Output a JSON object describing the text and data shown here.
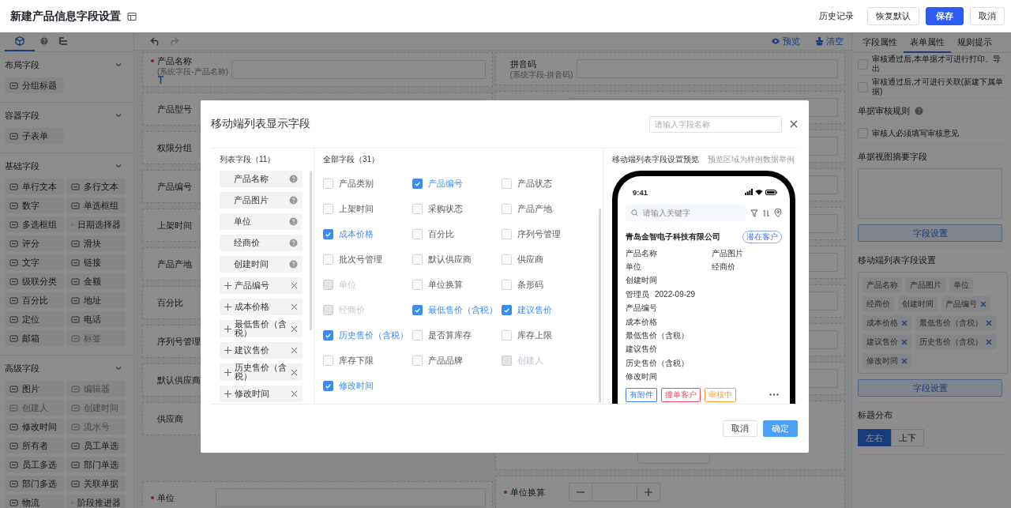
{
  "header": {
    "title": "新建产品信息字段设置",
    "actions": [
      {
        "label": "历史记录",
        "kind": "link"
      },
      {
        "label": "恢复默认",
        "kind": "default"
      },
      {
        "label": "保存",
        "kind": "primary"
      },
      {
        "label": "取消",
        "kind": "default"
      }
    ]
  },
  "palette": {
    "tabs": [
      {
        "selected": true
      },
      {
        "selected": false
      },
      {
        "selected": false
      }
    ],
    "groups": [
      {
        "title": "布局字段",
        "expanded": true,
        "items": [
          {
            "label": "分组标题",
            "disabled": false
          }
        ]
      },
      {
        "title": "容器字段",
        "expanded": true,
        "items": [
          {
            "label": "子表单",
            "disabled": false
          }
        ]
      },
      {
        "title": "基础字段",
        "expanded": true,
        "items": [
          {
            "label": "单行文本",
            "disabled": false
          },
          {
            "label": "多行文本",
            "disabled": false
          },
          {
            "label": "数字",
            "disabled": false
          },
          {
            "label": "单选框组",
            "disabled": false
          },
          {
            "label": "多选框组",
            "disabled": false
          },
          {
            "label": "日期选择器",
            "disabled": false
          },
          {
            "label": "评分",
            "disabled": false
          },
          {
            "label": "滑块",
            "disabled": false
          },
          {
            "label": "文字",
            "disabled": false
          },
          {
            "label": "链接",
            "disabled": false
          },
          {
            "label": "级联分类",
            "disabled": false
          },
          {
            "label": "金额",
            "disabled": false
          },
          {
            "label": "百分比",
            "disabled": false
          },
          {
            "label": "地址",
            "disabled": false
          },
          {
            "label": "定位",
            "disabled": false
          },
          {
            "label": "电话",
            "disabled": false
          },
          {
            "label": "邮箱",
            "disabled": false
          },
          {
            "label": "标签",
            "disabled": true
          }
        ]
      },
      {
        "title": "高级字段",
        "expanded": true,
        "items": [
          {
            "label": "图片",
            "disabled": false
          },
          {
            "label": "编辑器",
            "disabled": true
          },
          {
            "label": "创建人",
            "disabled": true
          },
          {
            "label": "创建时间",
            "disabled": true
          },
          {
            "label": "修改时间",
            "disabled": false
          },
          {
            "label": "流水号",
            "disabled": true
          },
          {
            "label": "所有者",
            "disabled": false
          },
          {
            "label": "员工单选",
            "disabled": false
          },
          {
            "label": "员工多选",
            "disabled": false
          },
          {
            "label": "部门单选",
            "disabled": false
          },
          {
            "label": "部门多选",
            "disabled": false
          },
          {
            "label": "关联单据",
            "disabled": false
          },
          {
            "label": "物流",
            "disabled": false
          },
          {
            "label": "阶段推进器",
            "disabled": false
          }
        ]
      }
    ]
  },
  "canvas": {
    "actions": [
      {
        "label": "预览",
        "kind": "preview"
      },
      {
        "label": "清空",
        "kind": "clear"
      }
    ],
    "left_fields": [
      {
        "label": "产品名称",
        "hint": "(系统字段-产品名称)",
        "required": true,
        "selected": true
      },
      {
        "label": "产品型号",
        "required": false,
        "selected": false
      },
      {
        "label": "权限分组",
        "required": false,
        "selected": false
      },
      {
        "label": "产品编号",
        "required": false,
        "selected": false
      },
      {
        "label": "上架时间",
        "required": false,
        "selected": false
      },
      {
        "label": "产品产地",
        "required": false,
        "selected": false
      },
      {
        "label": "百分比",
        "required": false,
        "selected": false
      },
      {
        "label": "序列号管理",
        "required": false,
        "selected": false
      },
      {
        "label": "默认供应商",
        "required": false,
        "selected": false
      },
      {
        "label": "供应商",
        "required": false,
        "selected": false
      },
      {
        "label": "单位",
        "required": true,
        "selected": false
      }
    ],
    "right_fields": [
      {
        "label": "拼音码",
        "hint": "(系统字段-拼音码)",
        "required": false,
        "selected": false,
        "kind": "input"
      },
      {
        "label": "单位换算",
        "required": true,
        "selected": false,
        "kind": "stepper"
      }
    ]
  },
  "props": {
    "tabs": [
      {
        "label": "字段属性",
        "selected": false
      },
      {
        "label": "表单属性",
        "selected": true
      },
      {
        "label": "规则提示",
        "selected": false
      }
    ],
    "options": [
      {
        "label": "审核通过后,本单据才可进行打印、导出",
        "checked": false
      },
      {
        "label": "审核通过后,才可进行关联(新建下属单据)",
        "checked": false
      }
    ],
    "review_rule": {
      "title": "单据审核规则",
      "options": [
        {
          "label": "审核人必须填写审核意见",
          "checked": false
        }
      ]
    },
    "summary": {
      "title": "单据视图摘要字段",
      "button": "字段设置"
    },
    "mobile_list": {
      "title": "移动端列表字段设置",
      "button": "字段设置",
      "tags": [
        {
          "label": "产品名称",
          "removable": false
        },
        {
          "label": "产品图片",
          "removable": false
        },
        {
          "label": "单位",
          "removable": false
        },
        {
          "label": "经商价",
          "removable": false
        },
        {
          "label": "创建时间",
          "removable": false
        },
        {
          "label": "产品编号",
          "removable": true
        },
        {
          "label": "成本价格",
          "removable": true
        },
        {
          "label": "最低售价（含税）",
          "removable": true
        },
        {
          "label": "建议售价",
          "removable": true
        },
        {
          "label": "历史售价（含税）",
          "removable": true
        },
        {
          "label": "修改时间",
          "removable": true
        }
      ]
    },
    "title_layout": {
      "title": "标题分布",
      "options": [
        {
          "label": "左右",
          "selected": true
        },
        {
          "label": "上下",
          "selected": false
        }
      ]
    }
  },
  "modal": {
    "title": "移动端列表显示字段",
    "search": {
      "placeholder": "请输入字段名称"
    },
    "list": {
      "title": "列表字段（11）",
      "items": [
        {
          "label": "产品名称",
          "kind": "fixed"
        },
        {
          "label": "产品图片",
          "kind": "fixed"
        },
        {
          "label": "单位",
          "kind": "fixed"
        },
        {
          "label": "经商价",
          "kind": "fixed"
        },
        {
          "label": "创建时间",
          "kind": "fixed"
        },
        {
          "label": "产品编号",
          "kind": "removable"
        },
        {
          "label": "成本价格",
          "kind": "removable"
        },
        {
          "label": "最低售价（含税）",
          "kind": "removable"
        },
        {
          "label": "建议售价",
          "kind": "removable"
        },
        {
          "label": "历史售价（含税）",
          "kind": "removable"
        },
        {
          "label": "修改时间",
          "kind": "removable"
        }
      ]
    },
    "all": {
      "title": "全部字段（31）",
      "items": [
        {
          "label": "产品类别",
          "checked": false,
          "disabled": false
        },
        {
          "label": "产品编号",
          "checked": true,
          "disabled": false
        },
        {
          "label": "产品状态",
          "checked": false,
          "disabled": false
        },
        {
          "label": "上架时间",
          "checked": false,
          "disabled": false
        },
        {
          "label": "采购状态",
          "checked": false,
          "disabled": false
        },
        {
          "label": "产品产地",
          "checked": false,
          "disabled": false
        },
        {
          "label": "成本价格",
          "checked": true,
          "disabled": false
        },
        {
          "label": "百分比",
          "checked": false,
          "disabled": false
        },
        {
          "label": "序列号管理",
          "checked": false,
          "disabled": false
        },
        {
          "label": "批次号管理",
          "checked": false,
          "disabled": false
        },
        {
          "label": "默认供应商",
          "checked": false,
          "disabled": false
        },
        {
          "label": "供应商",
          "checked": false,
          "disabled": false
        },
        {
          "label": "单位",
          "checked": false,
          "disabled": true
        },
        {
          "label": "单位换算",
          "checked": false,
          "disabled": false
        },
        {
          "label": "条形码",
          "checked": false,
          "disabled": false
        },
        {
          "label": "经商价",
          "checked": false,
          "disabled": true
        },
        {
          "label": "最低售价（含税）",
          "checked": true,
          "disabled": false
        },
        {
          "label": "建议售价",
          "checked": true,
          "disabled": false
        },
        {
          "label": "历史售价（含税）",
          "checked": true,
          "disabled": false
        },
        {
          "label": "是否算库存",
          "checked": false,
          "disabled": false
        },
        {
          "label": "库存上限",
          "checked": false,
          "disabled": false
        },
        {
          "label": "库存下限",
          "checked": false,
          "disabled": false
        },
        {
          "label": "产品品牌",
          "checked": false,
          "disabled": false
        },
        {
          "label": "创建人",
          "checked": false,
          "disabled": true
        },
        {
          "label": "修改时间",
          "checked": true,
          "disabled": false
        }
      ]
    },
    "preview": {
      "title": "移动端列表字段设置预览",
      "note": "预览区域为样例数据举例",
      "phone": {
        "time": "9:41",
        "search_placeholder": "请输入关键字",
        "company": "青岛金智电子科技有限公司",
        "status": "潜在客户",
        "rows": [
          {
            "kind": "columns",
            "cells": [
              "产品名称",
              "产品图片"
            ]
          },
          {
            "kind": "columns",
            "cells": [
              "单位",
              "经商价"
            ]
          },
          {
            "kind": "columns",
            "cells": [
              "创建时间"
            ]
          },
          {
            "kind": "inline",
            "cells": [
              "管理员",
              "2022-09-29"
            ]
          },
          {
            "kind": "columns",
            "cells": [
              "产品编号"
            ]
          },
          {
            "kind": "columns",
            "cells": [
              "成本价格"
            ]
          },
          {
            "kind": "columns",
            "cells": [
              "最低售价（含税）"
            ]
          },
          {
            "kind": "columns",
            "cells": [
              "建议售价"
            ]
          },
          {
            "kind": "columns",
            "cells": [
              "历史售价（含税）"
            ]
          },
          {
            "kind": "columns",
            "cells": [
              "修改时间"
            ]
          }
        ],
        "tags": [
          {
            "label": "有附件",
            "color": "#3b7ff5"
          },
          {
            "label": "撞单客户",
            "color": "#f5455c"
          },
          {
            "label": "审核中",
            "color": "#fa9b2a"
          }
        ]
      }
    },
    "buttons": [
      {
        "label": "取消",
        "kind": "default"
      },
      {
        "label": "确定",
        "kind": "primary"
      }
    ]
  }
}
